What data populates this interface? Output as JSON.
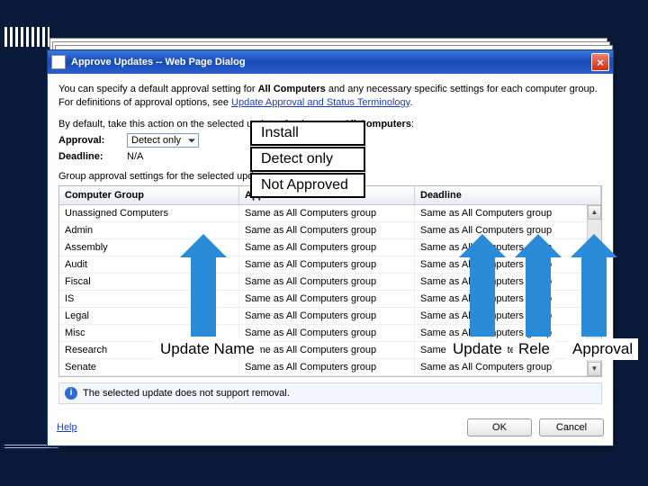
{
  "window": {
    "title": "Approve Updates -- Web Page Dialog",
    "close_icon": "×"
  },
  "intro": {
    "pre": "You can specify a default approval setting for ",
    "bold1": "All Computers",
    "mid": " and any necessary specific settings for each computer group. For definitions of approval options, see ",
    "link": "Update Approval and Status Terminology",
    "post": "."
  },
  "default_row": {
    "pre": "By default, take this action on the selected updates for the group ",
    "bold": "All Computers",
    "post": ":"
  },
  "approval": {
    "label": "Approval:",
    "value": "Detect only"
  },
  "deadline": {
    "label": "Deadline:",
    "value": "N/A"
  },
  "group_section": "Group approval settings for the selected updates:",
  "columns": {
    "c1": "Computer Group",
    "c2": "Approval",
    "c3": "Deadline"
  },
  "rows": [
    {
      "g": "Unassigned Computers",
      "a": "Same as All Computers group",
      "d": "Same as All Computers group"
    },
    {
      "g": "Admin",
      "a": "Same as All Computers group",
      "d": "Same as All Computers group"
    },
    {
      "g": "Assembly",
      "a": "Same as All Computers group",
      "d": "Same as All Computers group"
    },
    {
      "g": "Audit",
      "a": "Same as All Computers group",
      "d": "Same as All Computers group"
    },
    {
      "g": "Fiscal",
      "a": "Same as All Computers group",
      "d": "Same as All Computers group"
    },
    {
      "g": "IS",
      "a": "Same as All Computers group",
      "d": "Same as All Computers group"
    },
    {
      "g": "Legal",
      "a": "Same as All Computers group",
      "d": "Same as All Computers group"
    },
    {
      "g": "Misc",
      "a": "Same as All Computers group",
      "d": "Same as All Computers group"
    },
    {
      "g": "Research",
      "a": "Same as All Computers group",
      "d": "Same as All Computers group"
    },
    {
      "g": "Senate",
      "a": "Same as All Computers group",
      "d": "Same as All Computers group"
    }
  ],
  "info": "The selected update does not support removal.",
  "buttons": {
    "help": "Help",
    "ok": "OK",
    "cancel": "Cancel"
  },
  "overlay": {
    "opt1": "Install",
    "opt2": "Detect only",
    "opt3": "Not Approved",
    "ann1": "Update Name",
    "ann2": "Update",
    "ann3": "Rele",
    "ann4": "Approval"
  }
}
